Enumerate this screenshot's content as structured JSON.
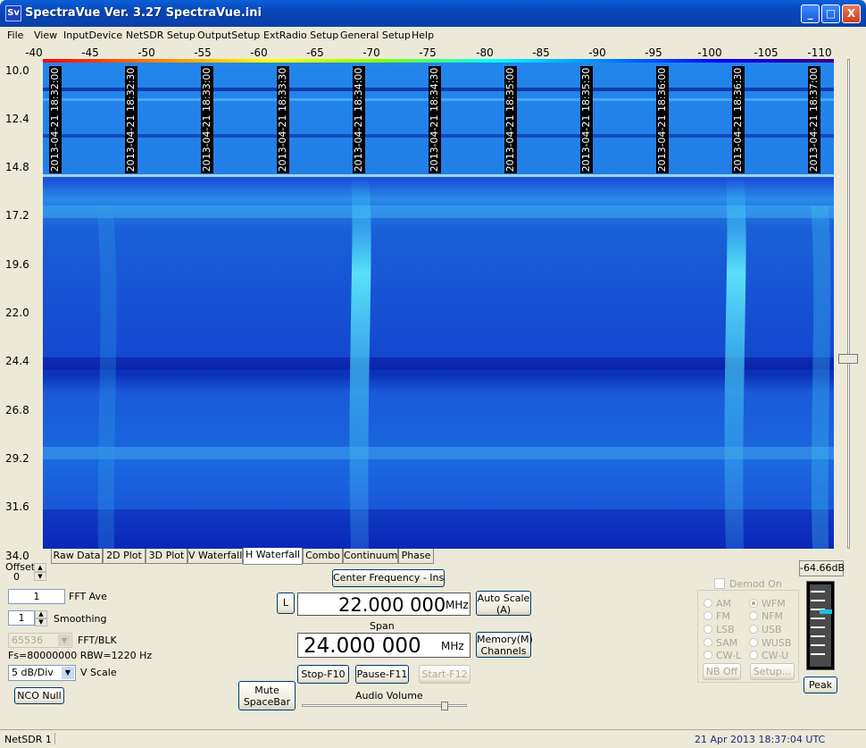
{
  "window": {
    "title": "SpectraVue Ver. 3.27  SpectraVue.ini",
    "icon_text": "Sv",
    "minimize": "_",
    "maximize": "□",
    "close": "X"
  },
  "menu": [
    "File",
    "View",
    "InputDevice",
    "NetSDR Setup",
    "OutputSetup",
    "ExtRadio Setup",
    "General Setup",
    "Help"
  ],
  "x_axis_ticks": [
    "-40",
    "-45",
    "-50",
    "-55",
    "-60",
    "-65",
    "-70",
    "-75",
    "-80",
    "-85",
    "-90",
    "-95",
    "-100",
    "-105",
    "-110"
  ],
  "y_axis_ticks": [
    "10.0",
    "12.4",
    "14.8",
    "17.2",
    "19.6",
    "22.0",
    "24.4",
    "26.8",
    "29.2",
    "31.6",
    "34.0"
  ],
  "timestamps": [
    "2013-04-21 18:32:00",
    "2013-04-21 18:32:30",
    "2013-04-21 18:33:00",
    "2013-04-21 18:33:30",
    "2013-04-21 18:34:00",
    "2013-04-21 18:34:30",
    "2013-04-21 18:35:00",
    "2013-04-21 18:35:30",
    "2013-04-21 18:36:00",
    "2013-04-21 18:36:30",
    "2013-04-21 18:37:00"
  ],
  "tabs": [
    "Raw Data",
    "2D Plot",
    "3D Plot",
    "V Waterfall",
    "H Waterfall",
    "Combo",
    "Continuum",
    "Phase"
  ],
  "active_tab": "H Waterfall",
  "controls": {
    "offset_label": "Offset",
    "offset_value": "0",
    "fft_ave_value": "1",
    "fft_ave_label": "FFT Ave",
    "smoothing_value": "1",
    "smoothing_label": "Smoothing",
    "fft_blk_value": "65536",
    "fft_blk_label": "FFT/BLK",
    "fs_info": "Fs=80000000 RBW=1220 Hz",
    "vscale_value": "5 dB/Div",
    "vscale_label": "V Scale",
    "nco_null": "NCO Null",
    "mute_line1": "Mute",
    "mute_line2": "SpaceBar",
    "center_freq_button": "Center Frequency - Ins",
    "l_button": "L",
    "center_freq_value": "22.000 000",
    "center_freq_unit": "MHz",
    "auto_scale_line1": "Auto Scale",
    "auto_scale_line2": "(A)",
    "span_label": "Span",
    "span_value": "24.000 000",
    "span_unit": "MHz",
    "memory_line1": "Memory(M)",
    "memory_line2": "Channels",
    "stop": "Stop-F10",
    "pause": "Pause-F11",
    "start": "Start-F12",
    "audio_volume": "Audio Volume",
    "audio_volume_level": 0.88,
    "demod_on": "Demod On",
    "demod_modes": [
      "AM",
      "WFM",
      "FM",
      "NFM",
      "LSB",
      "USB",
      "SAM",
      "WUSB",
      "CW-L",
      "CW-U"
    ],
    "demod_selected": "WFM",
    "nb_off": "NB Off",
    "setup": "Setup...",
    "level_readout": "-64.66dB",
    "peak": "Peak"
  },
  "status": {
    "left": "NetSDR 1",
    "right": "21 Apr 2013  18:37:04 UTC"
  }
}
